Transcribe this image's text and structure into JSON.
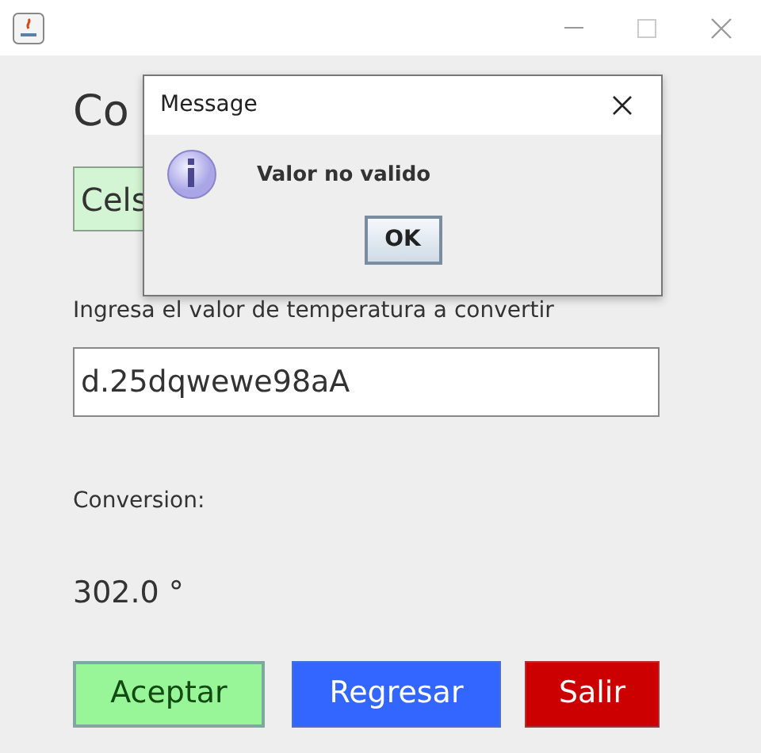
{
  "app": {
    "heading": "Co",
    "unit_select": {
      "value": "Cels"
    },
    "input_label": "Ingresa el valor de temperatura a convertir",
    "input": {
      "value": "d.25dqwewe98aA"
    },
    "result_label": "Conversion:",
    "result": "302.0 °",
    "buttons": [
      {
        "label": "Aceptar",
        "kind": "accept"
      },
      {
        "label": "Regresar",
        "kind": "back"
      },
      {
        "label": "Salir",
        "kind": "exit"
      }
    ]
  },
  "dialog": {
    "title": "Message",
    "message": "Valor no valido",
    "button": "OK"
  }
}
